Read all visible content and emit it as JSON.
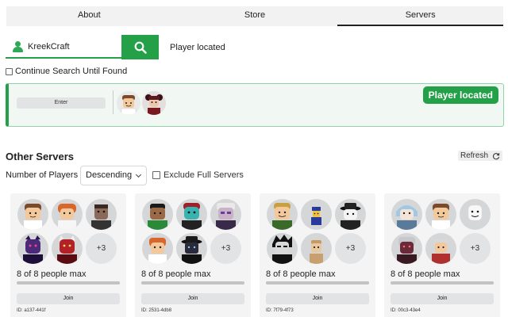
{
  "tabs": [
    {
      "label": "About",
      "active": false
    },
    {
      "label": "Store",
      "active": false
    },
    {
      "label": "Servers",
      "active": true
    }
  ],
  "search": {
    "value": "KreekCraft",
    "status": "Player located",
    "continue_label": "Continue Search Until Found",
    "continue_checked": false
  },
  "located": {
    "enter_label": "Enter",
    "badge": "Player located"
  },
  "other_servers": {
    "title": "Other Servers",
    "refresh_label": "Refresh",
    "filter_label": "Number of Players",
    "sort_value": "Descending",
    "exclude_label": "Exclude Full Servers",
    "exclude_checked": false
  },
  "servers": [
    {
      "players": "8 of 8 people max",
      "fill": 1.0,
      "join": "Join",
      "id": "ID: a137-441f",
      "extra": "+3"
    },
    {
      "players": "8 of 8 people max",
      "fill": 1.0,
      "join": "Join",
      "id": "ID: 2531-4db8",
      "extra": "+3"
    },
    {
      "players": "8 of 8 people max",
      "fill": 1.0,
      "join": "Join",
      "id": "ID: 7f79-4f73",
      "extra": "+3"
    },
    {
      "players": "8 of 8 people max",
      "fill": 1.0,
      "join": "Join",
      "id": "ID: 00c3-43e4",
      "extra": "+3"
    }
  ],
  "colors": {
    "accent": "#24a148",
    "card_bg": "#f4f4f5",
    "button_bg": "#e2e3e5"
  },
  "icons": {
    "search": "search-icon",
    "user": "user-icon",
    "refresh": "refresh-icon",
    "chevron": "chevron-down-icon"
  }
}
